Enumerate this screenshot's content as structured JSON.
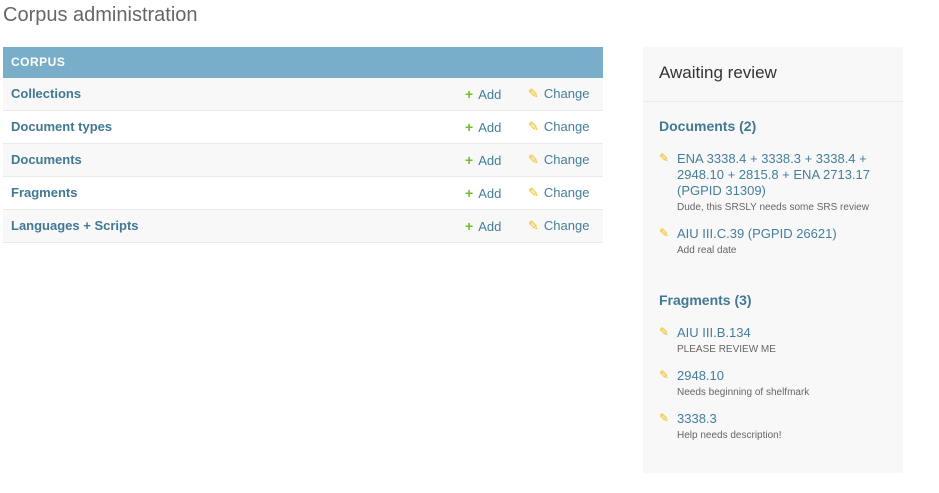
{
  "page": {
    "title": "Corpus administration"
  },
  "module": {
    "caption": "CORPUS",
    "rows": [
      {
        "name": "Collections",
        "add": "Add",
        "change": "Change"
      },
      {
        "name": "Document types",
        "add": "Add",
        "change": "Change"
      },
      {
        "name": "Documents",
        "add": "Add",
        "change": "Change"
      },
      {
        "name": "Fragments",
        "add": "Add",
        "change": "Change"
      },
      {
        "name": "Languages + Scripts",
        "add": "Add",
        "change": "Change"
      }
    ]
  },
  "sidebar": {
    "title": "Awaiting review",
    "documents": {
      "heading": "Documents (2)",
      "items": [
        {
          "link": "ENA 3338.4 + 3338.3 + 3338.4 + 2948.10 + 2815.8 + ENA 2713.17 (PGPID 31309)",
          "note": "Dude, this SRSLY needs some SRS review"
        },
        {
          "link": "AIU III.C.39 (PGPID 26621)",
          "note": "Add real date"
        }
      ]
    },
    "fragments": {
      "heading": "Fragments (3)",
      "items": [
        {
          "link": "AIU III.B.134",
          "note": "PLEASE REVIEW ME"
        },
        {
          "link": "2948.10",
          "note": "Needs beginning of shelfmark"
        },
        {
          "link": "3338.3",
          "note": "Help needs description!"
        }
      ]
    }
  },
  "icons": {
    "add": "plus-icon",
    "change": "pencil-icon"
  },
  "colors": {
    "header": "#79aec8",
    "link": "#447e9b",
    "add": "#70bf2b",
    "pencil": "#efb80b"
  }
}
